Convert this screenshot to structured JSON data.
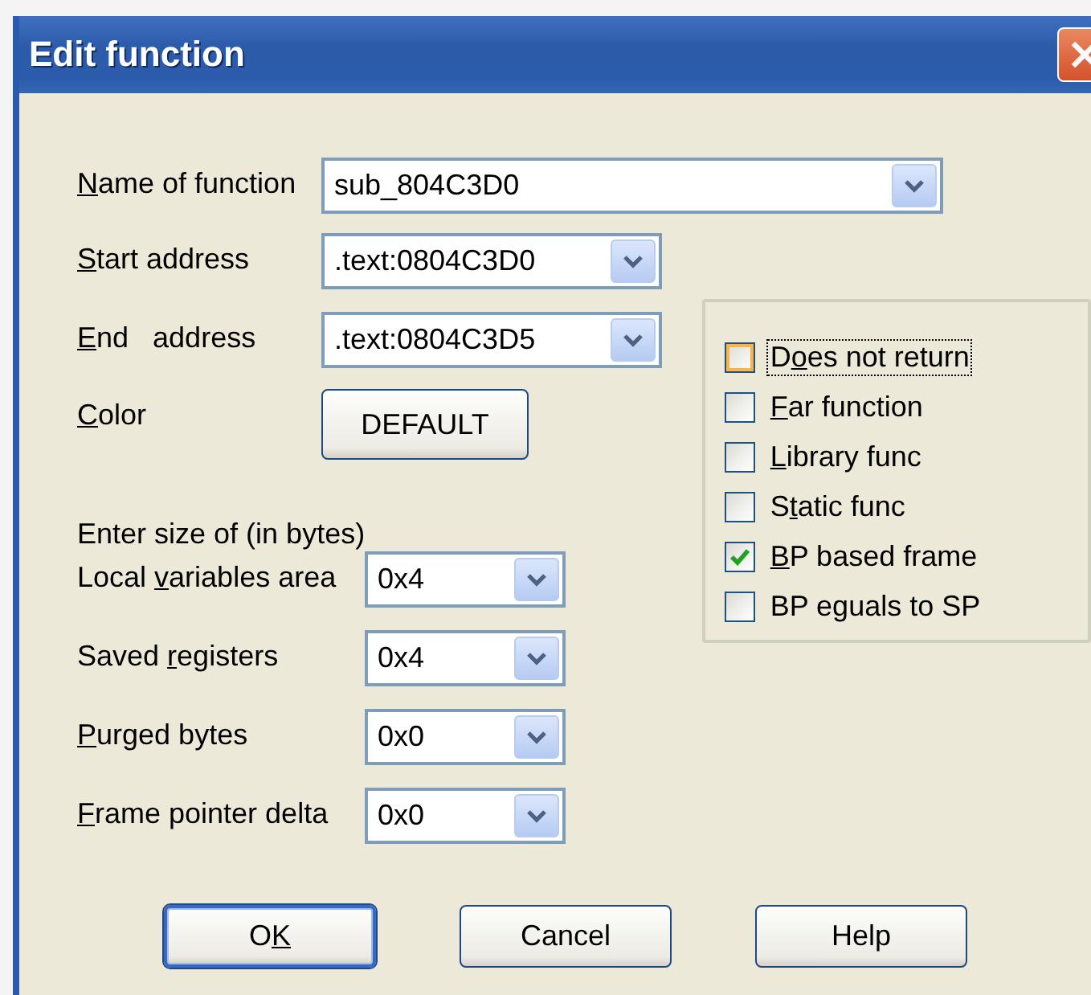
{
  "window": {
    "title": "Edit function"
  },
  "fields": [
    {
      "label": {
        "key": "N",
        "post": "ame of function"
      },
      "value": "sub_804C3D0"
    },
    {
      "label": {
        "key": "S",
        "post": "tart address"
      },
      "value": ".text:0804C3D0"
    },
    {
      "label": {
        "key": "E",
        "post": "nd   address"
      },
      "value": ".text:0804C3D5"
    }
  ],
  "color": {
    "label": {
      "key": "C",
      "post": "olor"
    },
    "button": "DEFAULT"
  },
  "size_section": {
    "heading": "Enter size of (in bytes)",
    "fields": [
      {
        "label": {
          "pre": "Local ",
          "key": "v",
          "post": "ariables area"
        },
        "value": "0x4"
      },
      {
        "label": {
          "pre": "Saved ",
          "key": "r",
          "post": "egisters"
        },
        "value": "0x4"
      },
      {
        "label": {
          "key": "P",
          "post": "urged bytes"
        },
        "value": "0x0"
      },
      {
        "label": {
          "key": "F",
          "post": "rame pointer delta"
        },
        "value": "0x0"
      }
    ]
  },
  "options": [
    {
      "label": {
        "pre": "D",
        "key": "o",
        "post": "es not return"
      },
      "checked": false,
      "focused": true
    },
    {
      "label": {
        "key": "F",
        "post": "ar function"
      },
      "checked": false,
      "focused": false
    },
    {
      "label": {
        "key": "L",
        "post": "ibrary func"
      },
      "checked": false,
      "focused": false
    },
    {
      "label": {
        "pre": "S",
        "key": "t",
        "post": "atic func"
      },
      "checked": false,
      "focused": false
    },
    {
      "label": {
        "key": "B",
        "post": "P based frame"
      },
      "checked": true,
      "focused": false
    },
    {
      "label": {
        "pre": "BP eguals to SP"
      },
      "checked": false,
      "focused": false
    }
  ],
  "buttons": [
    {
      "label": {
        "pre": "O",
        "key": "K"
      },
      "default": true
    },
    {
      "label": {
        "pre": "Cancel"
      },
      "default": false
    },
    {
      "label": {
        "pre": "Help"
      },
      "default": false
    }
  ]
}
